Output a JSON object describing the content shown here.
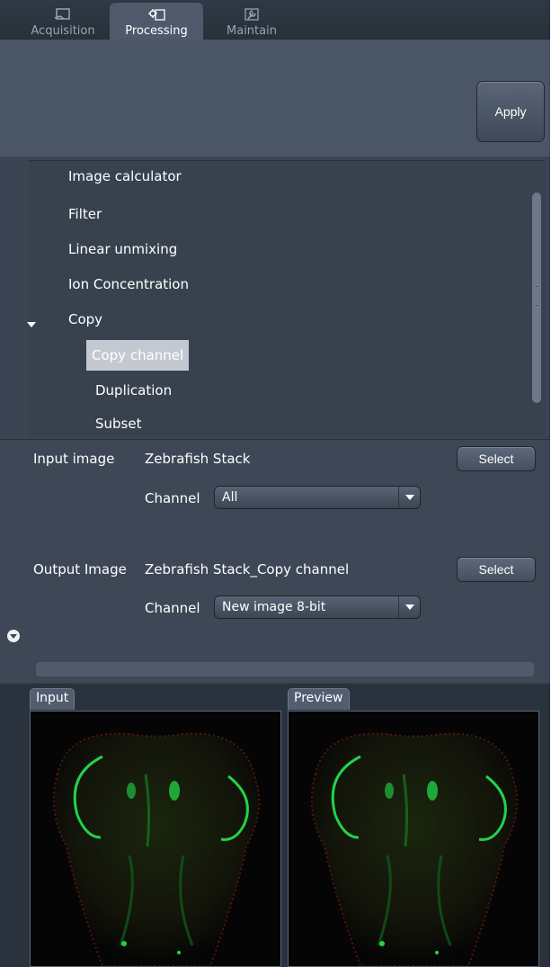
{
  "tabs": [
    {
      "label": "Acquisition",
      "icon": "acquisition-icon",
      "active": false
    },
    {
      "label": "Processing",
      "icon": "processing-gear-icon",
      "active": true
    },
    {
      "label": "Maintain",
      "icon": "maintain-wrench-icon",
      "active": false
    }
  ],
  "toolbar": {
    "apply_label": "Apply"
  },
  "tree": {
    "items": [
      {
        "label": "Image calculator"
      },
      {
        "label": "Filter"
      },
      {
        "label": "Linear unmixing"
      },
      {
        "label": "Ion Concentration"
      },
      {
        "label": "Copy",
        "expanded": true
      },
      {
        "label": "Copy channel",
        "selected": true
      },
      {
        "label": "Duplication"
      },
      {
        "label": "Subset"
      }
    ]
  },
  "form": {
    "input_label": "Input image",
    "input_value": "Zebrafish Stack",
    "input_select": "Select",
    "input_channel_label": "Channel",
    "input_channel_value": "All",
    "output_label": "Output Image",
    "output_value": "Zebrafish Stack_Copy channel",
    "output_select": "Select",
    "output_channel_label": "Channel",
    "output_channel_value": "New image 8-bit"
  },
  "panels": {
    "input_label": "Input",
    "preview_label": "Preview"
  },
  "colors": {
    "background": "#3a4453",
    "selected_item": "#c4c9d1",
    "fluorescence_green": "#22d24a",
    "fluorescence_red": "#b02a1e"
  }
}
